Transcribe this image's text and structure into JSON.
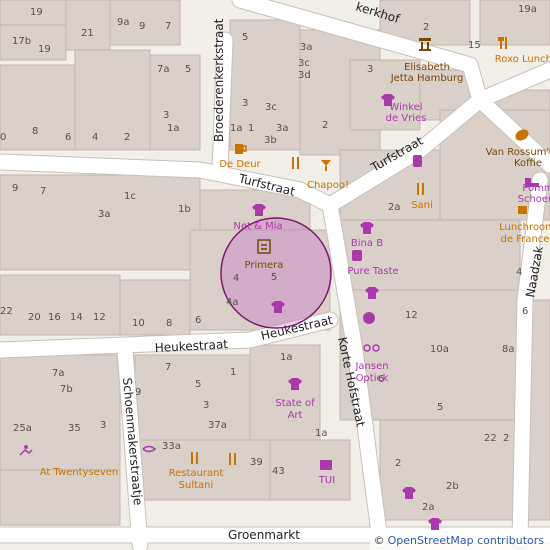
{
  "map": {
    "streets": {
      "kerkhof": "kerkhof",
      "broederenkerkstraat": "Broederenkerkstraat",
      "turfstraat_w": "Turfstraat",
      "turfstraat_e": "Turfstraat",
      "heukestraat_w": "Heukestraat",
      "heukestraat_e": "Heukestraat",
      "korte_hofstraat": "Korte Hofstraat",
      "schoenmakerstraatje": "Schoenmakerstraatje",
      "groenmarkt": "Groenmarkt",
      "naadzak": "Naadzak"
    },
    "pois": {
      "elisabeth_1": "Elisabeth",
      "elisabeth_2": "Jetta Hamburg",
      "roxo": "Roxo Lunchcafé",
      "winkel_1": "Winkel",
      "winkel_2": "de Vries",
      "vanrossum_1": "Van Rossum's",
      "vanrossum_2": "Koffie",
      "pomm_1": "Pomm",
      "pomm_2": "Schoen",
      "dedeur": "De Deur",
      "chapoo": "Chapoo!",
      "sani": "Sani",
      "lunchroom_1": "Lunchroom",
      "lunchroom_2": "de France",
      "netmia": "Net & Mia",
      "primera": "Primera",
      "binab": "Bina B",
      "puretaste": "Pure Taste",
      "jansen_1": "Jansen",
      "jansen_2": "Optiek",
      "stateofart_1": "State of",
      "stateofart_2": "Art",
      "twentyseven": "At Twentyseven",
      "sultani_1": "Restaurant",
      "sultani_2": "Sultani",
      "tui": "TUI"
    },
    "house_numbers": {
      "h19": "19",
      "h9a": "9a",
      "h9": "9",
      "h7": "7",
      "h17b": "17b",
      "h21": "21",
      "h19b": "19",
      "h5a": "5",
      "h3a": "3a",
      "h3c": "3c",
      "h3d": "3d",
      "h3": "3",
      "h2": "2",
      "h19a": "19a",
      "h15": "15",
      "h7a": "7a",
      "h5b": "5",
      "h3b1": "3",
      "h1a": "1a",
      "h8": "8",
      "h6": "6",
      "h4": "4",
      "h2b": "2",
      "h0": "0",
      "h3_2": "3",
      "h1a2": "1a",
      "h1": "1",
      "h3c2": "3c",
      "h3a2": "3a",
      "h3b": "3b",
      "h2c": "2",
      "h9b": "9",
      "h7b": "7",
      "h1c": "1c",
      "h1b": "1b",
      "h3a3": "3a",
      "h2a": "2a",
      "h4b": "4",
      "h5c": "5",
      "h4c": "4",
      "h4a": "4a",
      "h22": "22",
      "h20": "20",
      "h16": "16",
      "h14": "14",
      "h12": "12",
      "h10": "10",
      "h8b": "8",
      "h6b": "6",
      "h12b": "12",
      "h10a": "10a",
      "h8a": "8a",
      "h6c": "6",
      "h7a2": "7a",
      "h7b2": "7b",
      "h9c": "9",
      "h7c": "7",
      "h5d": "5",
      "h3e": "3",
      "h1d": "1",
      "h1a3": "1a",
      "h25a": "25a",
      "h35": "35",
      "h33a": "33a",
      "h37a": "37a",
      "h39": "39",
      "h43": "43",
      "h1a4": "1a",
      "h3f": "3",
      "h5e": "5",
      "h2d": "2",
      "h2b2": "2b",
      "h2a2": "2a",
      "h22b": "22",
      "h2c2": "2"
    },
    "selection": {
      "center_label": "Primera",
      "number": "5"
    }
  },
  "attribution": {
    "symbol": "©",
    "text": "OpenStreetMap contributors"
  },
  "colors": {
    "background": "#f2efe9",
    "building": "#d9d0c9",
    "building_stroke": "#c4b6ab",
    "road": "#ffffff",
    "road_casing": "#c8c1b8",
    "poi_shop": "#ac39ac",
    "poi_food": "#c77400",
    "poi_amenity": "#734a08",
    "selection_fill": "#c02cc0",
    "selection_stroke": "#7a1a6e"
  }
}
